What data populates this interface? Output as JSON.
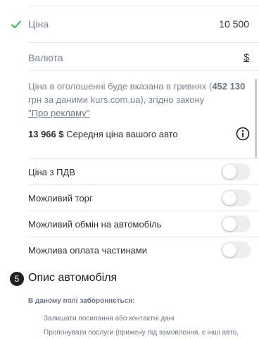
{
  "price": {
    "label": "Ціна",
    "value": "10 500"
  },
  "currency": {
    "label": "Валюта",
    "value": "$"
  },
  "note": {
    "prefix": "Ціна в оголошенні буде вказана в гривнях (",
    "amount": "452 130",
    "line2": "грн за даними kurs.com.ua), згідно закону",
    "link": "\"Про рекламу\""
  },
  "average": {
    "value": "13 966 $",
    "label": "Середня ціна вашого авто"
  },
  "toggles": [
    {
      "label": "Ціна з ПДВ",
      "on": false
    },
    {
      "label": "Можливий торг",
      "on": false
    },
    {
      "label": "Можливий обмін на автомобіль",
      "on": false
    },
    {
      "label": "Можлива оплата частинами",
      "on": false
    }
  ],
  "section": {
    "number": "5",
    "title": "Опис автомобіля"
  },
  "rules": {
    "title": "В даному полі забороняється:",
    "items": [
      "Залишати посилання або контактні дані",
      "Пропонувати послуги (прижену під замовлення, є інші авто,"
    ]
  },
  "colors": {
    "check": "#2db84d",
    "toggle_off": "#eeeeee"
  },
  "icons": {
    "check": "check-icon",
    "info": "info-icon"
  }
}
